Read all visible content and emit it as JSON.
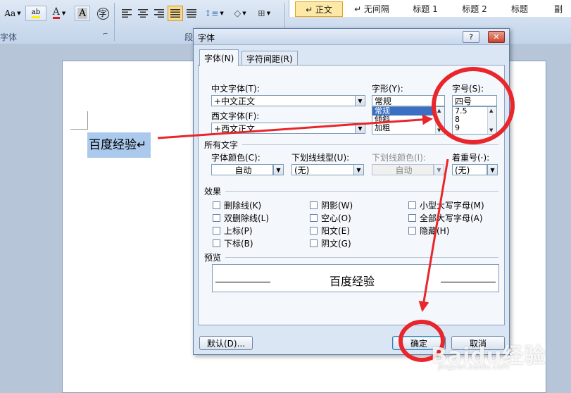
{
  "ribbon": {
    "change_case": "Aa",
    "highlight": "ab",
    "font_color": "A",
    "char_shading": "A",
    "enclose_char": "字",
    "group_font_label": "字体",
    "group_para_label": "段",
    "styles": [
      "↵ 正文",
      "↵ 无间隔",
      "标题 1",
      "标题 2",
      "标题",
      "副"
    ]
  },
  "document": {
    "text": "百度经验↵"
  },
  "dialog": {
    "title": "字体",
    "help": "?",
    "close": "✕",
    "tabs": [
      "字体(N)",
      "字符间距(R)"
    ],
    "chinese_font_label": "中文字体(T):",
    "chinese_font_value": "+中文正文",
    "western_font_label": "西文字体(F):",
    "western_font_value": "+西文正文",
    "style_label": "字形(Y):",
    "style_value": "常规",
    "style_options": [
      "常规",
      "倾斜",
      "加粗"
    ],
    "size_label": "字号(S):",
    "size_value": "四号",
    "size_options": [
      "7.5",
      "8",
      "9"
    ],
    "all_text_label": "所有文字",
    "font_color_label": "字体颜色(C):",
    "font_color_value": "自动",
    "underline_label": "下划线线型(U):",
    "underline_value": "(无)",
    "underline_color_label": "下划线颜色(I):",
    "underline_color_value": "自动",
    "emphasis_label": "着重号(·):",
    "emphasis_value": "(无)",
    "effects_label": "效果",
    "effects": [
      "删除线(K)",
      "阴影(W)",
      "小型大写字母(M)",
      "双删除线(L)",
      "空心(O)",
      "全部大写字母(A)",
      "上标(P)",
      "阳文(E)",
      "隐藏(H)",
      "下标(B)",
      "阴文(G)"
    ],
    "preview_label": "预览",
    "preview_text": "百度经验",
    "default_button": "默认(D)...",
    "ok_button": "确定",
    "cancel_button": "取消"
  },
  "watermark": {
    "brand": "Baidu经验",
    "url": "jingyan.baidu.com"
  },
  "colors": {
    "annotation_red": "#e8262b",
    "selection_blue": "#3a6fc4",
    "text_highlight": "#aac9ec"
  }
}
